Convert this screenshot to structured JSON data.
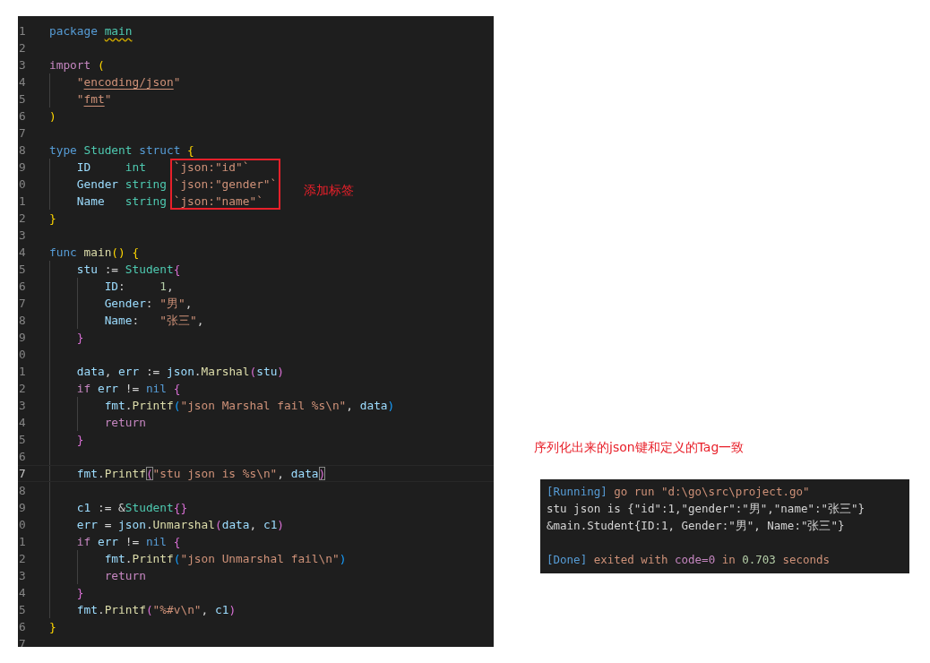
{
  "editor": {
    "lines": [
      {
        "number": "1",
        "tokens": [
          {
            "kind": "keyword",
            "text": "package "
          },
          {
            "kind": "type",
            "text": "main",
            "warning": true
          }
        ]
      },
      {
        "number": "2"
      },
      {
        "number": "3",
        "tokens": [
          {
            "kind": "control",
            "text": "import "
          },
          {
            "kind": "bracket1",
            "text": "("
          }
        ],
        "children": [
          {
            "number": "4",
            "tokens": [
              {
                "kind": "string",
                "text": "\""
              },
              {
                "kind": "string",
                "text": "encoding/json",
                "link": true
              },
              {
                "kind": "string",
                "text": "\""
              }
            ]
          },
          {
            "number": "5",
            "tokens": [
              {
                "kind": "string",
                "text": "\""
              },
              {
                "kind": "string",
                "text": "fmt",
                "link": true
              },
              {
                "kind": "string",
                "text": "\""
              }
            ]
          }
        ]
      },
      {
        "number": "6",
        "tokens": [
          {
            "kind": "bracket1",
            "text": ")"
          }
        ]
      },
      {
        "number": "7"
      },
      {
        "number": "8",
        "tokens": [
          {
            "kind": "keyword",
            "text": "type "
          },
          {
            "kind": "type",
            "text": "Student "
          },
          {
            "kind": "keyword",
            "text": "struct "
          },
          {
            "kind": "bracket1",
            "text": "{"
          }
        ],
        "children": [
          {
            "number": "9",
            "tokens": [
              {
                "kind": "variable",
                "text": "ID     "
              },
              {
                "kind": "type",
                "text": "int    "
              },
              {
                "kind": "string",
                "text": "`json:\"id\"`",
                "boxed": true
              }
            ]
          },
          {
            "number": "0",
            "tokens": [
              {
                "kind": "variable",
                "text": "Gender "
              },
              {
                "kind": "type",
                "text": "string "
              },
              {
                "kind": "string",
                "text": "`json:\"gender\"`",
                "boxed": true
              }
            ]
          },
          {
            "number": "1",
            "tokens": [
              {
                "kind": "variable",
                "text": "Name   "
              },
              {
                "kind": "type",
                "text": "string "
              },
              {
                "kind": "string",
                "text": "`json:\"name\"`",
                "boxed": true
              }
            ]
          }
        ]
      },
      {
        "number": "2",
        "tokens": [
          {
            "kind": "bracket1",
            "text": "}"
          }
        ]
      },
      {
        "number": "3"
      },
      {
        "number": "4",
        "tokens": [
          {
            "kind": "keyword",
            "text": "func "
          },
          {
            "kind": "function",
            "text": "main"
          },
          {
            "kind": "bracket1",
            "text": "() {"
          }
        ],
        "children": [
          {
            "number": "5",
            "tokens": [
              {
                "kind": "variable",
                "text": "stu"
              },
              {
                "kind": "plain",
                "text": " := "
              },
              {
                "kind": "type",
                "text": "Student"
              },
              {
                "kind": "bracket2",
                "text": "{"
              }
            ],
            "children": [
              {
                "number": "6",
                "tokens": [
                  {
                    "kind": "variable",
                    "text": "ID"
                  },
                  {
                    "kind": "plain",
                    "text": ":     "
                  },
                  {
                    "kind": "number",
                    "text": "1"
                  },
                  {
                    "kind": "plain",
                    "text": ","
                  }
                ]
              },
              {
                "number": "7",
                "tokens": [
                  {
                    "kind": "variable",
                    "text": "Gender"
                  },
                  {
                    "kind": "plain",
                    "text": ": "
                  },
                  {
                    "kind": "string",
                    "text": "\"男\""
                  },
                  {
                    "kind": "plain",
                    "text": ","
                  }
                ]
              },
              {
                "number": "8",
                "tokens": [
                  {
                    "kind": "variable",
                    "text": "Name"
                  },
                  {
                    "kind": "plain",
                    "text": ":   "
                  },
                  {
                    "kind": "string",
                    "text": "\"张三\""
                  },
                  {
                    "kind": "plain",
                    "text": ","
                  }
                ]
              }
            ]
          },
          {
            "number": "9",
            "tokens": [
              {
                "kind": "bracket2",
                "text": "}"
              }
            ]
          },
          {
            "number": "0"
          },
          {
            "number": "1",
            "tokens": [
              {
                "kind": "variable",
                "text": "data"
              },
              {
                "kind": "plain",
                "text": ", "
              },
              {
                "kind": "variable",
                "text": "err"
              },
              {
                "kind": "plain",
                "text": " := "
              },
              {
                "kind": "variable",
                "text": "json"
              },
              {
                "kind": "plain",
                "text": "."
              },
              {
                "kind": "function",
                "text": "Marshal"
              },
              {
                "kind": "bracket2",
                "text": "("
              },
              {
                "kind": "variable",
                "text": "stu"
              },
              {
                "kind": "bracket2",
                "text": ")"
              }
            ]
          },
          {
            "number": "2",
            "tokens": [
              {
                "kind": "control",
                "text": "if "
              },
              {
                "kind": "variable",
                "text": "err"
              },
              {
                "kind": "plain",
                "text": " != "
              },
              {
                "kind": "keyword",
                "text": "nil "
              },
              {
                "kind": "bracket2",
                "text": "{"
              }
            ],
            "children": [
              {
                "number": "3",
                "tokens": [
                  {
                    "kind": "variable",
                    "text": "fmt"
                  },
                  {
                    "kind": "plain",
                    "text": "."
                  },
                  {
                    "kind": "function",
                    "text": "Printf"
                  },
                  {
                    "kind": "bracket3",
                    "text": "("
                  },
                  {
                    "kind": "string",
                    "text": "\"json Marshal fail %s\\n\""
                  },
                  {
                    "kind": "plain",
                    "text": ", "
                  },
                  {
                    "kind": "variable",
                    "text": "data"
                  },
                  {
                    "kind": "bracket3",
                    "text": ")"
                  }
                ]
              },
              {
                "number": "4",
                "tokens": [
                  {
                    "kind": "control",
                    "text": "return"
                  }
                ]
              }
            ]
          },
          {
            "number": "5",
            "tokens": [
              {
                "kind": "bracket2",
                "text": "}"
              }
            ]
          },
          {
            "number": "6"
          },
          {
            "number": "7",
            "current": true,
            "tokens": [
              {
                "kind": "variable",
                "text": "fmt"
              },
              {
                "kind": "plain",
                "text": "."
              },
              {
                "kind": "function",
                "text": "Printf"
              },
              {
                "kind": "bracket2",
                "text": "(",
                "match": true
              },
              {
                "kind": "string",
                "text": "\"stu json is %s\\n\""
              },
              {
                "kind": "plain",
                "text": ", "
              },
              {
                "kind": "variable",
                "text": "data"
              },
              {
                "kind": "bracket2",
                "text": ")",
                "match": true
              }
            ]
          },
          {
            "number": "8"
          },
          {
            "number": "9",
            "tokens": [
              {
                "kind": "variable",
                "text": "c1"
              },
              {
                "kind": "plain",
                "text": " := &"
              },
              {
                "kind": "type",
                "text": "Student"
              },
              {
                "kind": "bracket2",
                "text": "{}"
              }
            ]
          },
          {
            "number": "0",
            "tokens": [
              {
                "kind": "variable",
                "text": "err"
              },
              {
                "kind": "plain",
                "text": " = "
              },
              {
                "kind": "variable",
                "text": "json"
              },
              {
                "kind": "plain",
                "text": "."
              },
              {
                "kind": "function",
                "text": "Unmarshal"
              },
              {
                "kind": "bracket2",
                "text": "("
              },
              {
                "kind": "variable",
                "text": "data"
              },
              {
                "kind": "plain",
                "text": ", "
              },
              {
                "kind": "variable",
                "text": "c1"
              },
              {
                "kind": "bracket2",
                "text": ")"
              }
            ]
          },
          {
            "number": "1",
            "tokens": [
              {
                "kind": "control",
                "text": "if "
              },
              {
                "kind": "variable",
                "text": "err"
              },
              {
                "kind": "plain",
                "text": " != "
              },
              {
                "kind": "keyword",
                "text": "nil "
              },
              {
                "kind": "bracket2",
                "text": "{"
              }
            ],
            "children": [
              {
                "number": "2",
                "tokens": [
                  {
                    "kind": "variable",
                    "text": "fmt"
                  },
                  {
                    "kind": "plain",
                    "text": "."
                  },
                  {
                    "kind": "function",
                    "text": "Printf"
                  },
                  {
                    "kind": "bracket3",
                    "text": "("
                  },
                  {
                    "kind": "string",
                    "text": "\"json Unmarshal fail\\n\""
                  },
                  {
                    "kind": "bracket3",
                    "text": ")"
                  }
                ]
              },
              {
                "number": "3",
                "tokens": [
                  {
                    "kind": "control",
                    "text": "return"
                  }
                ]
              }
            ]
          },
          {
            "number": "4",
            "tokens": [
              {
                "kind": "bracket2",
                "text": "}"
              }
            ]
          },
          {
            "number": "5",
            "tokens": [
              {
                "kind": "variable",
                "text": "fmt"
              },
              {
                "kind": "plain",
                "text": "."
              },
              {
                "kind": "function",
                "text": "Printf"
              },
              {
                "kind": "bracket2",
                "text": "("
              },
              {
                "kind": "string",
                "text": "\"%#v\\n\""
              },
              {
                "kind": "plain",
                "text": ", "
              },
              {
                "kind": "variable",
                "text": "c1"
              },
              {
                "kind": "bracket2",
                "text": ")"
              }
            ]
          }
        ]
      },
      {
        "number": "6",
        "tokens": [
          {
            "kind": "bracket1",
            "text": "}"
          }
        ]
      },
      {
        "number": "7"
      }
    ],
    "annotation": {
      "label": "添加标签"
    }
  },
  "caption": "序列化出来的json键和定义的Tag一致",
  "terminal": {
    "lines": [
      {
        "tokens": [
          {
            "kind": "tag",
            "text": "[Running]"
          },
          {
            "kind": "string",
            "text": " go run \"d:\\go\\src\\project.go\""
          }
        ]
      },
      {
        "tokens": [
          {
            "kind": "plain",
            "text": "stu json is {\"id\":1,\"gender\":\"男\",\"name\":\"张三\"}"
          }
        ]
      },
      {
        "tokens": [
          {
            "kind": "plain",
            "text": "&main.Student{ID:1, Gender:\"男\", Name:\"张三\"}"
          }
        ]
      },
      {
        "gap_before": true,
        "tokens": [
          {
            "kind": "tag",
            "text": "[Done]"
          },
          {
            "kind": "string",
            "text": " exited with "
          },
          {
            "kind": "control",
            "text": "code=0"
          },
          {
            "kind": "string",
            "text": " in "
          },
          {
            "kind": "number",
            "text": "0.703"
          },
          {
            "kind": "string",
            "text": " seconds"
          }
        ]
      }
    ]
  }
}
